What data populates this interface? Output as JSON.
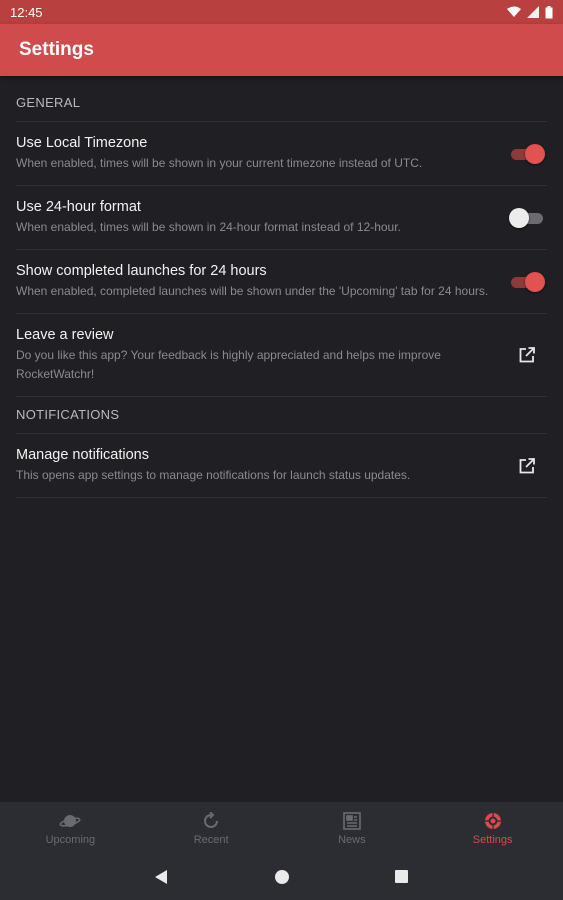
{
  "status_bar": {
    "time": "12:45"
  },
  "app_bar": {
    "title": "Settings"
  },
  "sections": {
    "general": {
      "header": "GENERAL"
    },
    "notifications": {
      "header": "NOTIFICATIONS"
    }
  },
  "settings": {
    "local_timezone": {
      "title": "Use Local Timezone",
      "description": "When enabled, times will be shown in your current timezone instead of UTC.",
      "enabled": true
    },
    "hour_format": {
      "title": "Use 24-hour format",
      "description": "When enabled, times will be shown in 24-hour format instead of 12-hour.",
      "enabled": false
    },
    "completed_launches": {
      "title": "Show completed launches for 24 hours",
      "description": "When enabled, completed launches will be shown under the 'Upcoming' tab for 24 hours.",
      "enabled": true
    },
    "leave_review": {
      "title": "Leave a review",
      "description": "Do you like this app? Your feedback is highly appreciated and helps me improve RocketWatchr!",
      "icon": "open-external-icon"
    },
    "manage_notifications": {
      "title": "Manage notifications",
      "description": "This opens app settings to manage notifications for launch status updates.",
      "icon": "open-external-icon"
    }
  },
  "bottom_nav": {
    "items": [
      {
        "label": "Upcoming",
        "icon": "planet-icon",
        "active": false
      },
      {
        "label": "Recent",
        "icon": "refresh-icon",
        "active": false
      },
      {
        "label": "News",
        "icon": "newspaper-icon",
        "active": false
      },
      {
        "label": "Settings",
        "icon": "settings-icon",
        "active": true
      }
    ]
  },
  "colors": {
    "accent": "#d04b4b",
    "status_bar": "#b8403f",
    "background": "#1f1f24",
    "nav_background": "#2c2c33"
  }
}
